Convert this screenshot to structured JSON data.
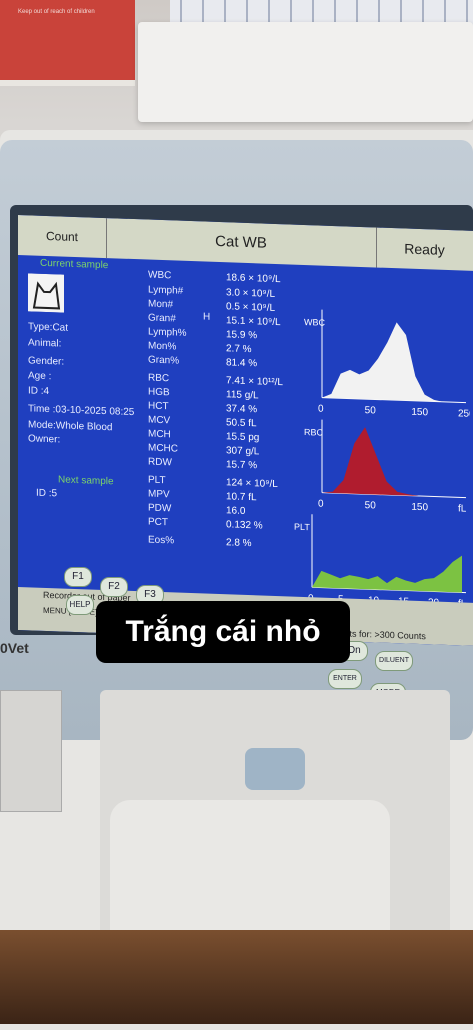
{
  "screen": {
    "tab_count": "Count",
    "title": "Cat WB",
    "status": "Ready",
    "current_sample": "Current sample",
    "type": "Type:Cat",
    "animal": "Animal:",
    "gender": "Gender:",
    "age": "Age  :",
    "id": "ID   :4",
    "time": "Time :03-10-2025 08:25",
    "mode": "Mode:Whole Blood",
    "owner": "Owner:",
    "next_sample": "Next sample",
    "next_id": "ID   :5",
    "message": "Recorder out of paper",
    "menu_line": "MENU  [MODE]Select count mode.[F1]Next sample.[F2]Unclog.[F3]Startup.",
    "reagents": "Reagents for: >300 Counts",
    "flag": "H",
    "results": [
      {
        "name": "WBC",
        "value": "18.6 × 10⁹/L"
      },
      {
        "name": "Lymph#",
        "value": "3.0 × 10⁹/L"
      },
      {
        "name": "Mon#",
        "value": "0.5 × 10⁹/L"
      },
      {
        "name": "Gran#",
        "value": "15.1 × 10⁹/L"
      },
      {
        "name": "Lymph%",
        "value": "15.9 %"
      },
      {
        "name": "Mon%",
        "value": "2.7 %"
      },
      {
        "name": "Gran%",
        "value": "81.4 %"
      },
      {
        "name": "RBC",
        "value": "7.41 × 10¹²/L"
      },
      {
        "name": "HGB",
        "value": "115 g/L"
      },
      {
        "name": "HCT",
        "value": "37.4 %"
      },
      {
        "name": "MCV",
        "value": "50.5 fL"
      },
      {
        "name": "MCH",
        "value": "15.5 pg"
      },
      {
        "name": "MCHC",
        "value": "307 g/L"
      },
      {
        "name": "RDW",
        "value": "15.7 %"
      },
      {
        "name": "PLT",
        "value": "124 × 10⁹/L"
      },
      {
        "name": "MPV",
        "value": "10.7 fL"
      },
      {
        "name": "PDW",
        "value": "16.0"
      },
      {
        "name": "PCT",
        "value": "0.132 %"
      },
      {
        "name": "Eos%",
        "value": "2.8 %"
      }
    ],
    "wbc_axis": [
      "0",
      "50",
      "150",
      "250"
    ],
    "rbc_axis": [
      "0",
      "50",
      "150",
      "fL"
    ],
    "plt_axis": [
      "0",
      "5",
      "10",
      "15",
      "20",
      "fL"
    ],
    "hist_labels": {
      "wbc": "WBC",
      "rbc": "RBC",
      "plt": "PLT"
    },
    "colors": {
      "wbc": "#f2f2f2",
      "rbc": "#b01c2e",
      "plt": "#7cc242",
      "screen": "#1f3fbf"
    }
  },
  "keypad": {
    "f1": "F1",
    "f2": "F2",
    "f3": "F3",
    "help": "HELP",
    "on": "On",
    "diluent": "DILUENT",
    "enter": "ENTER",
    "mode": "MODE"
  },
  "brand": "0Vet",
  "overlay_caption": "Trắng cái nhỏ",
  "box_text": "Keep out of reach of children"
}
